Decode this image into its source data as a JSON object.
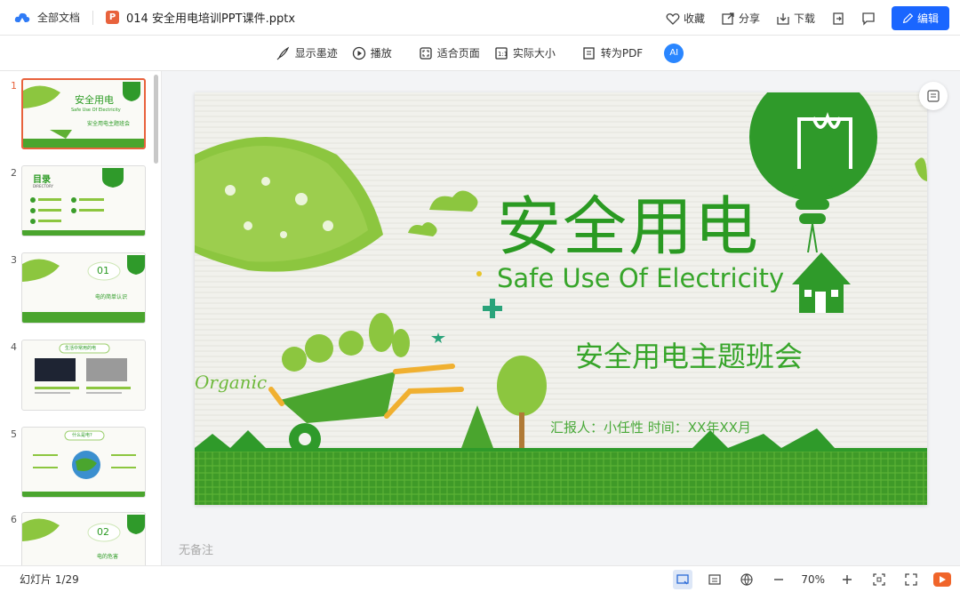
{
  "topbar": {
    "all_docs": "全部文档",
    "filename": "014 安全用电培训PPT课件.pptx",
    "file_badge": "P",
    "collect": "收藏",
    "share": "分享",
    "download": "下载",
    "edit": "编辑"
  },
  "toolbar": {
    "show_ink": "显示墨迹",
    "play": "播放",
    "fit_page": "适合页面",
    "actual_size": "实际大小",
    "to_pdf": "转为PDF",
    "ai": "AI"
  },
  "sidebar": {
    "thumbnails": [
      {
        "num": "1",
        "label": "安全用电",
        "sub": "Safe Use Of Electricity",
        "theme": "安全用电主题班会"
      },
      {
        "num": "2",
        "label": "目录",
        "sub": "DIRECTORY"
      },
      {
        "num": "3",
        "label": "01",
        "sub": "电的简单认识"
      },
      {
        "num": "4",
        "label": "生活中常用的电"
      },
      {
        "num": "5",
        "label": "什么是电?"
      },
      {
        "num": "6",
        "label": "02",
        "sub": "电的危害"
      }
    ]
  },
  "slide": {
    "title": "安全用电",
    "subtitle": "Safe Use Of Electricity",
    "theme": "安全用电主题班会",
    "reporter": "汇报人：小任性   时间：XX年XX月",
    "organic": "Organic"
  },
  "notes": "无备注",
  "status": {
    "slide_count": "幻灯片 1/29",
    "zoom": "70%"
  },
  "colors": {
    "accent_blue": "#1a66ff",
    "slide_green": "#2a9a22",
    "light_green": "#7cc52b",
    "pptx_orange": "#e8623c"
  }
}
